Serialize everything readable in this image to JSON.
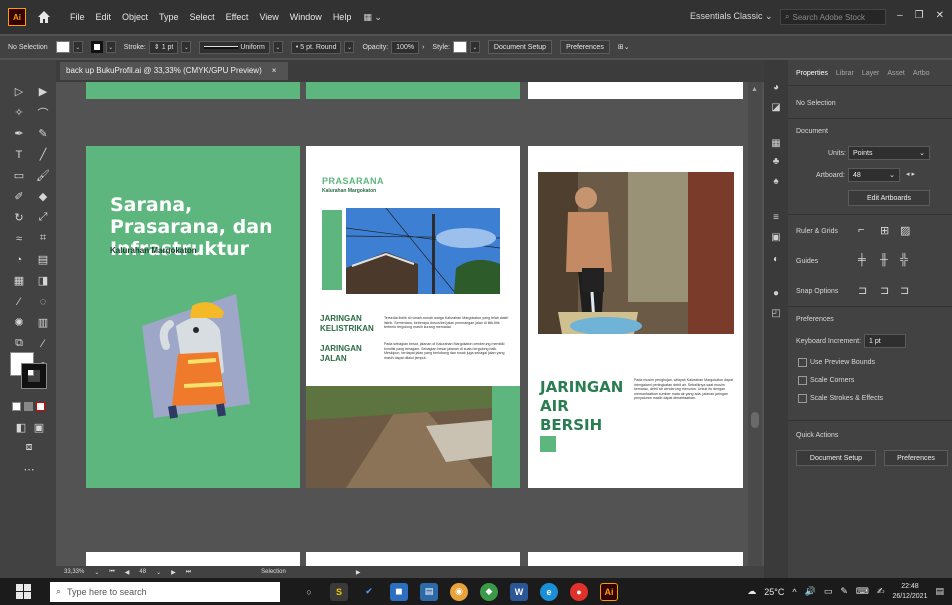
{
  "app": {
    "logo": "Ai",
    "menus": [
      "File",
      "Edit",
      "Object",
      "Type",
      "Select",
      "Effect",
      "View",
      "Window",
      "Help"
    ],
    "workspace": "Essentials Classic",
    "search_placeholder": "Search Adobe Stock"
  },
  "control": {
    "selection": "No Selection",
    "stroke_label": "Stroke:",
    "stroke_value": "1 pt",
    "profile": "Uniform",
    "brush": "5 pt. Round",
    "opacity_label": "Opacity:",
    "opacity_value": "100%",
    "style_label": "Style:",
    "document_setup": "Document Setup",
    "preferences": "Preferences"
  },
  "document": {
    "tab_title": "back up BukuProfil.ai @ 33,33% (CMYK/GPU Preview)",
    "close": "×"
  },
  "artboards": {
    "cover_title": "Sarana, Prasarana, dan Infrastruktur",
    "cover_subtitle": "Kalurahan Margokaton",
    "prasarana_title": "PRASARANA",
    "prasarana_sub": "Kalurahan Margokaton",
    "listrik_h": "JARINGAN KELISTRIKAN",
    "jalan_h": "JARINGAN JALAN",
    "listrik_p": "Tersedia listrik di rumah-rumah warga Kalurahan Margokaton yang telah dialiri listrik. Sementara, beberapa dusun/bel jalan penerangan jalan di titik-titik tertentu tergolong masih kurang memadai.",
    "jalan_p": "Pada sebagian besar, jalanan di Kalurahan Margokaton cenderung memiliki kondisi yang beragam. Sebagian besar jalanan di suatu tergolong baik. Meskipun, terdapat jalan yang berlubang dan rusak juga sebagai jalan yang masih dapat dilalui jemput.",
    "air_h": "JARINGAN AIR BERSIH",
    "air_p": "Pada musim penghujan, wilayah Kalurahan Margokaton dapat mengalami peningkatan debit air. Sebaliknya saat musim kemarau, debit air cenderung menurun. Untuk itu dengan memanfaatkan sumber mata air yang ada, jalanan jaringan penyaluran masih dapat dimanfaatkan."
  },
  "properties": {
    "tabs": [
      "Properties",
      "Librar",
      "Layer",
      "Asset",
      "Artbo"
    ],
    "no_selection": "No Selection",
    "document_label": "Document",
    "units_label": "Units:",
    "units_value": "Points",
    "artboard_label": "Artboard:",
    "artboard_value": "48",
    "edit_artboards": "Edit Artboards",
    "ruler_grids": "Ruler & Grids",
    "guides": "Guides",
    "snap_options": "Snap Options",
    "preferences": "Preferences",
    "keyboard_increment": "Keyboard Increment:",
    "keyboard_value": "1 pt",
    "use_preview_bounds": "Use Preview Bounds",
    "scale_corners": "Scale Corners",
    "scale_strokes": "Scale Strokes & Effects",
    "quick_actions": "Quick Actions",
    "qa_document_setup": "Document Setup",
    "qa_preferences": "Preferences"
  },
  "status": {
    "zoom": "33,33%",
    "artboard": "48",
    "mode": "Selection"
  },
  "taskbar": {
    "search_placeholder": "Type here to search",
    "temperature": "25°C",
    "time": "22:48",
    "date": "26/12/2021"
  },
  "colors": {
    "brand_green": "#5db67d",
    "dark_green": "#2a7d51",
    "ui_dark": "#323232",
    "ui_mid": "#424242",
    "canvas": "#535353"
  }
}
